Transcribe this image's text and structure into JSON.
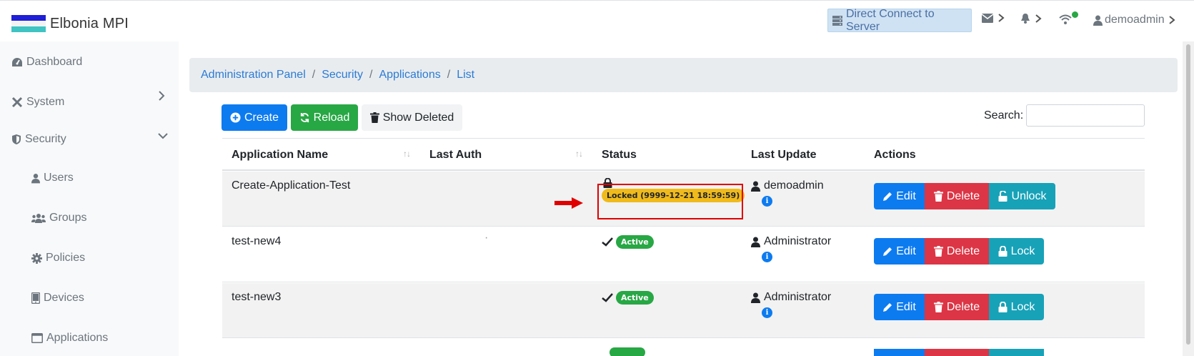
{
  "app": {
    "title": "Elbonia MPI"
  },
  "topbar": {
    "direct_connect": "Direct Connect to Server",
    "user": "demoadmin"
  },
  "sidebar": {
    "items": [
      {
        "label": "Dashboard",
        "icon": "dashboard-icon"
      },
      {
        "label": "System",
        "icon": "tools-icon"
      },
      {
        "label": "Security",
        "icon": "shield-icon"
      },
      {
        "label": "Users",
        "icon": "user-icon"
      },
      {
        "label": "Groups",
        "icon": "users-icon"
      },
      {
        "label": "Policies",
        "icon": "gear-icon"
      },
      {
        "label": "Devices",
        "icon": "tablet-icon"
      },
      {
        "label": "Applications",
        "icon": "window-icon"
      }
    ]
  },
  "breadcrumb": [
    "Administration Panel",
    "Security",
    "Applications",
    "List"
  ],
  "toolbar": {
    "create": "Create",
    "reload": "Reload",
    "show_deleted": "Show Deleted",
    "search_label": "Search:",
    "search_value": ""
  },
  "table": {
    "headers": [
      "Application Name",
      "Last Auth",
      "Status",
      "Last Update",
      "Actions"
    ],
    "rows": [
      {
        "name": "Create-Application-Test",
        "last_auth": "",
        "status": "Locked (9999-12-21 18:59:59)",
        "status_type": "locked",
        "updated_by": "demoadmin",
        "lock_action": "Unlock"
      },
      {
        "name": "test-new4",
        "last_auth": "·",
        "status": "Active",
        "status_type": "active",
        "updated_by": "Administrator",
        "lock_action": "Lock"
      },
      {
        "name": "test-new3",
        "last_auth": "",
        "status": "Active",
        "status_type": "active",
        "updated_by": "Administrator",
        "lock_action": "Lock"
      }
    ],
    "actions": {
      "edit": "Edit",
      "delete": "Delete"
    }
  },
  "colors": {
    "primary": "#0d7bf0",
    "success": "#28a745",
    "danger": "#dc3545",
    "info": "#17a2b8",
    "warning": "#f0ba1a",
    "highlight": "#e00000"
  }
}
